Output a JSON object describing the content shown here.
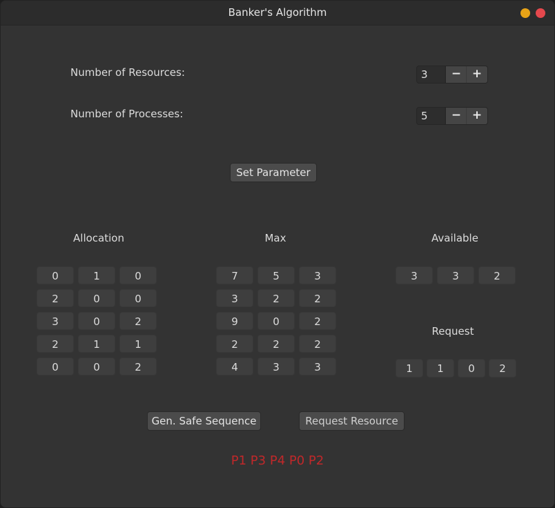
{
  "window": {
    "title": "Banker's Algorithm"
  },
  "params": {
    "resources_label": "Number of Resources:",
    "resources_value": "3",
    "processes_label": "Number of Processes:",
    "processes_value": "5",
    "minus_symbol": "−",
    "plus_symbol": "+",
    "set_button": "Set Parameter"
  },
  "allocation": {
    "title": "Allocation",
    "rows": [
      [
        "0",
        "1",
        "0"
      ],
      [
        "2",
        "0",
        "0"
      ],
      [
        "3",
        "0",
        "2"
      ],
      [
        "2",
        "1",
        "1"
      ],
      [
        "0",
        "0",
        "2"
      ]
    ]
  },
  "max": {
    "title": "Max",
    "rows": [
      [
        "7",
        "5",
        "3"
      ],
      [
        "3",
        "2",
        "2"
      ],
      [
        "9",
        "0",
        "2"
      ],
      [
        "2",
        "2",
        "2"
      ],
      [
        "4",
        "3",
        "3"
      ]
    ]
  },
  "available": {
    "title": "Available",
    "values": [
      "3",
      "3",
      "2"
    ]
  },
  "request": {
    "title": "Request",
    "values": [
      "1",
      "1",
      "0",
      "2"
    ]
  },
  "actions": {
    "safe_sequence_button": "Gen. Safe Sequence",
    "request_button": "Request Resource"
  },
  "result": {
    "text": "P1 P3 P4 P0 P2",
    "color": "#c0282a"
  },
  "colors": {
    "minimize": "#e8a317",
    "close": "#e5484d",
    "background": "#333333"
  }
}
